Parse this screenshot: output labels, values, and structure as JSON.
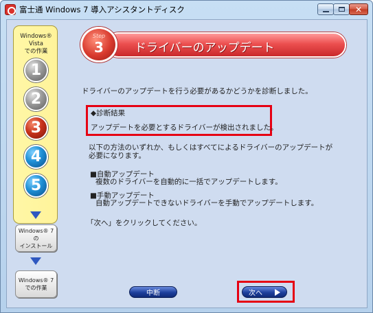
{
  "window": {
    "title": "富士通 Windows 7 導入アシスタントディスク"
  },
  "rail": {
    "title_line1": "Windows® Vista",
    "title_line2": "での作業",
    "steps": [
      "1",
      "2",
      "3",
      "4",
      "5"
    ],
    "current_step": 3,
    "install_box_line1": "Windows® 7 の",
    "install_box_line2": "インストール",
    "work_box_line1": "Windows® 7",
    "work_box_line2": "での作業"
  },
  "header": {
    "badge_word": "Step",
    "badge_number": "3",
    "title": "ドライバーのアップデート"
  },
  "main": {
    "intro": "ドライバーのアップデートを行う必要があるかどうかを診断しました。",
    "result_heading": "◆診断結果",
    "result_text": "アップデートを必要とするドライバーが検出されました。",
    "method_line1": "以下の方法のいずれか、もしくはすべてによるドライバーのアップデートが",
    "method_line2": "必要になります。",
    "auto_title": "■自動アップデート",
    "auto_desc": "複数のドライバーを自動的に一括でアップデートします。",
    "manual_title": "■手動アップデート",
    "manual_desc": "自動アップデートできないドライバーを手動でアップデートします。",
    "next_instruction": "「次へ」をクリックしてください。"
  },
  "buttons": {
    "cancel_label": "中断",
    "next_label": "次へ"
  },
  "colors": {
    "accent_red": "#e60012",
    "step_banner": "#ec4f4f",
    "rail_yellow": "#fff39a",
    "button_blue": "#1d3f9c"
  }
}
